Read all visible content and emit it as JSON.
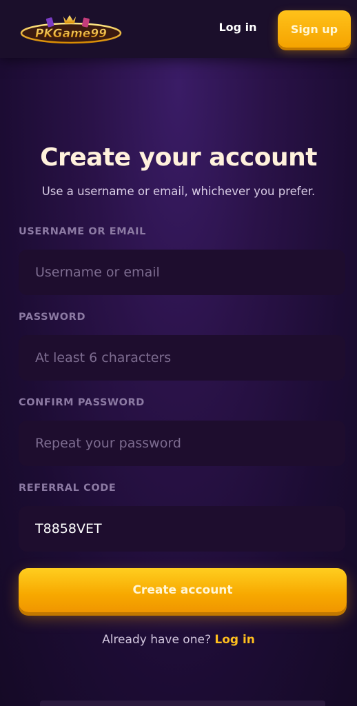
{
  "header": {
    "logo_text": "PKGame99",
    "login_label": "Log in",
    "signup_label": "Sign up"
  },
  "form": {
    "title": "Create your account",
    "subtitle": "Use a username or email, whichever you prefer.",
    "fields": [
      {
        "label": "USERNAME OR EMAIL",
        "placeholder": "Username or email",
        "value": ""
      },
      {
        "label": "PASSWORD",
        "placeholder": "At least 6 characters",
        "value": ""
      },
      {
        "label": "CONFIRM PASSWORD",
        "placeholder": "Repeat your password",
        "value": ""
      },
      {
        "label": "REFERRAL CODE",
        "placeholder": "",
        "value": "T8858VET"
      }
    ],
    "submit_label": "Create account",
    "footer_text": "Already have one?",
    "footer_link": "Log in"
  },
  "colors": {
    "accent": "#ffbf1e",
    "background": "#2a1248",
    "field_bg": "#1e0d2e"
  }
}
